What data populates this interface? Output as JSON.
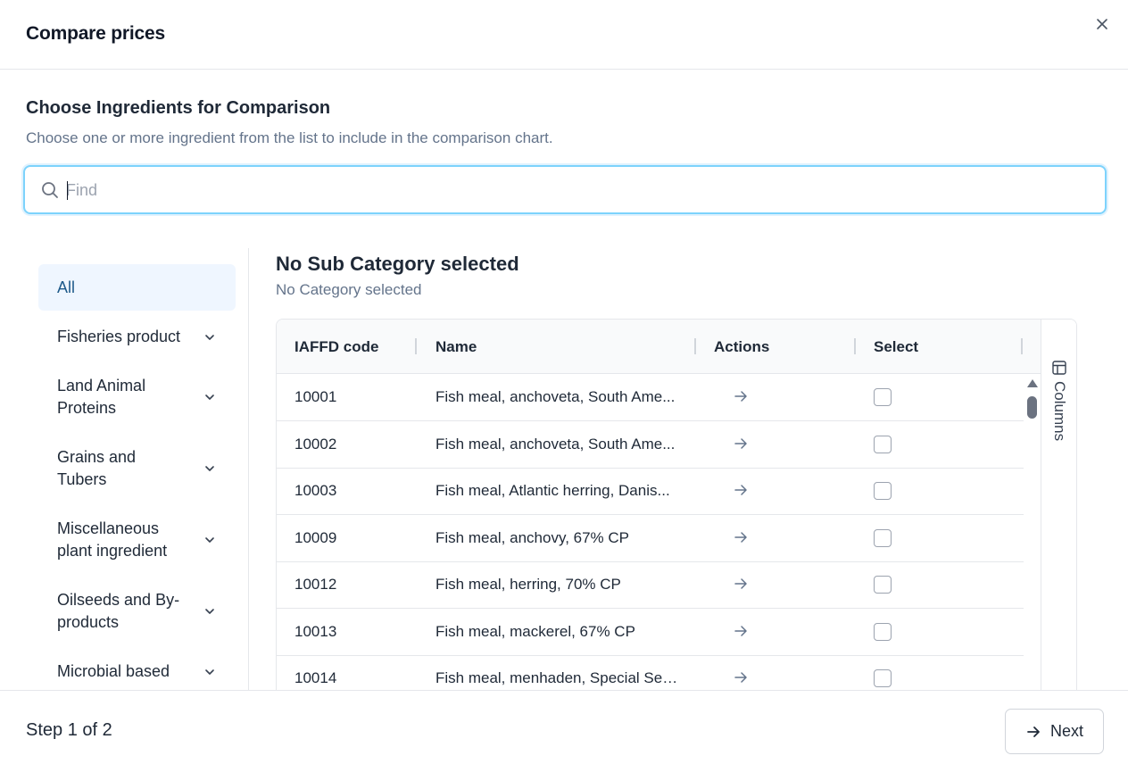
{
  "dialog": {
    "title": "Compare prices"
  },
  "section": {
    "title": "Choose Ingredients for Comparison",
    "subtitle": "Choose one or more ingredient from the list to include in the comparison chart."
  },
  "search": {
    "placeholder": "Find",
    "value": ""
  },
  "sidebar": {
    "items": [
      {
        "label": "All",
        "active": true,
        "expandable": false
      },
      {
        "label": "Fisheries product",
        "active": false,
        "expandable": true
      },
      {
        "label": "Land Animal Proteins",
        "active": false,
        "expandable": true
      },
      {
        "label": "Grains and Tubers",
        "active": false,
        "expandable": true
      },
      {
        "label": "Miscellaneous plant ingredient",
        "active": false,
        "expandable": true
      },
      {
        "label": "Oilseeds and By-products",
        "active": false,
        "expandable": true
      },
      {
        "label": "Microbial based",
        "active": false,
        "expandable": true
      }
    ]
  },
  "main": {
    "title": "No Sub Category selected",
    "subtitle": "No Category selected"
  },
  "table": {
    "columns": [
      "IAFFD code",
      "Name",
      "Actions",
      "Select"
    ],
    "rows": [
      {
        "code": "10001",
        "name": "Fish meal, anchoveta, South Ame...",
        "selected": false
      },
      {
        "code": "10002",
        "name": "Fish meal, anchoveta, South Ame...",
        "selected": false
      },
      {
        "code": "10003",
        "name": "Fish meal, Atlantic herring, Danis...",
        "selected": false
      },
      {
        "code": "10009",
        "name": "Fish meal, anchovy, 67% CP",
        "selected": false
      },
      {
        "code": "10012",
        "name": "Fish meal, herring, 70% CP",
        "selected": false
      },
      {
        "code": "10013",
        "name": "Fish meal, mackerel, 67% CP",
        "selected": false
      },
      {
        "code": "10014",
        "name": "Fish meal, menhaden, Special Sel...",
        "selected": false
      }
    ],
    "columns_panel_label": "Columns"
  },
  "footer": {
    "step": "Step 1 of 2",
    "next_label": "Next"
  },
  "icons": {
    "close": "close-icon",
    "search": "search-icon",
    "chevron": "chevron-down-icon",
    "action": "arrow-right-icon",
    "columns": "columns-icon",
    "next": "arrow-right-icon"
  },
  "colors": {
    "accent_border": "#7dd3fc",
    "active_bg": "#eff6ff",
    "active_text": "#1e5a8a",
    "muted_text": "#64748b"
  }
}
